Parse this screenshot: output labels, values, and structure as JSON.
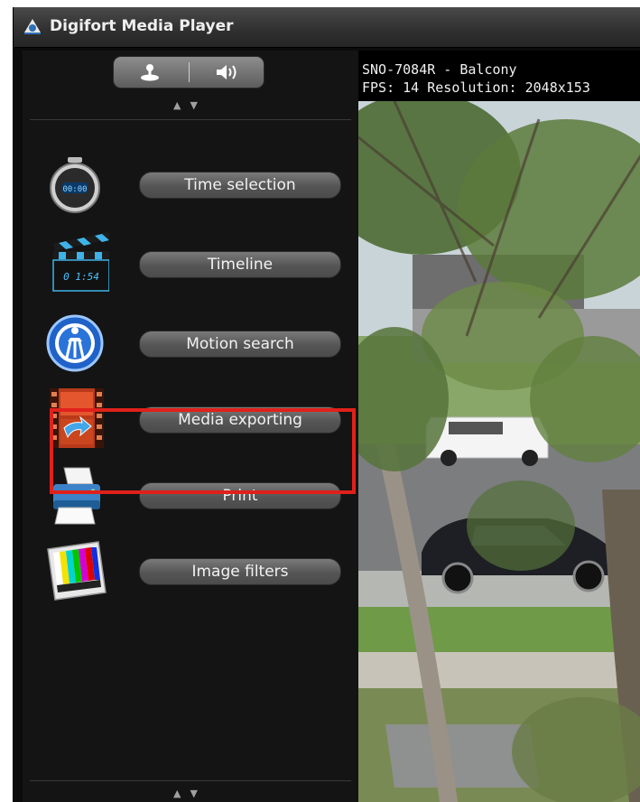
{
  "window": {
    "title": "Digifort Media Player"
  },
  "toolbar": {
    "tool_icon": "joystick-icon",
    "audio_icon": "speaker-icon"
  },
  "menu": {
    "items": [
      {
        "label": "Time selection",
        "icon": "stopwatch-icon"
      },
      {
        "label": "Timeline",
        "icon": "clapperboard-icon",
        "icon_text": "0 1:54"
      },
      {
        "label": "Motion search",
        "icon": "motion-search-icon"
      },
      {
        "label": "Media exporting",
        "icon": "film-export-icon",
        "highlighted": true
      },
      {
        "label": "Print",
        "icon": "printer-icon"
      },
      {
        "label": "Image filters",
        "icon": "test-pattern-icon"
      }
    ],
    "stopwatch_text": "00:00"
  },
  "video": {
    "camera_title": "SNO-7084R - Balcony",
    "info": "FPS: 14   Resolution: 2048x153"
  },
  "colors": {
    "highlight": "#e0211b",
    "background": "#141414",
    "button": "#5c5c5c"
  }
}
